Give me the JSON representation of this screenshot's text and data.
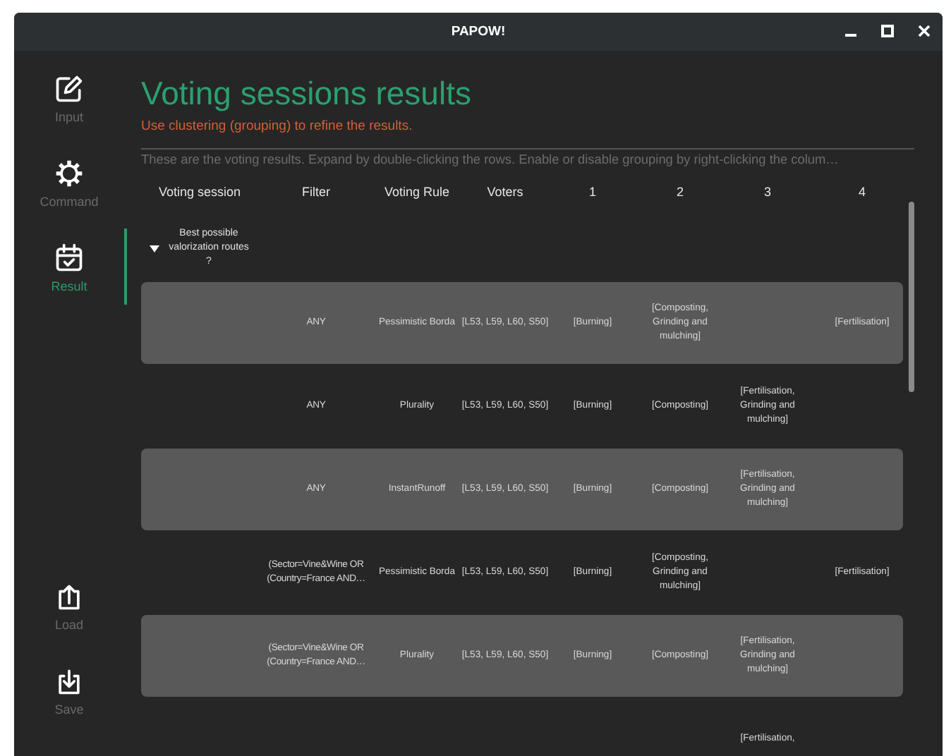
{
  "window": {
    "title": "PAPOW!"
  },
  "sidebar": {
    "top_items": [
      {
        "label": "Input",
        "selected": false
      },
      {
        "label": "Command",
        "selected": false
      },
      {
        "label": "Result",
        "selected": true
      }
    ],
    "bottom_items": [
      {
        "label": "Load",
        "selected": false
      },
      {
        "label": "Save",
        "selected": false
      }
    ]
  },
  "heading": "Voting sessions results",
  "hint": "Use clustering (grouping) to refine the results.",
  "description": "These are the voting results. Expand by double-clicking the rows. Enable or disable grouping by right-clicking the colum…",
  "table": {
    "columns": [
      "Voting session",
      "Filter",
      "Voting Rule",
      "Voters",
      "1",
      "2",
      "3",
      "4"
    ],
    "groups": [
      {
        "label": "Best possible valorization routes ?",
        "expanded": true,
        "rows": [
          {
            "shaded": true,
            "cells": [
              "",
              "ANY",
              "Pessimistic Borda",
              "[L53, L59, L60, S50]",
              "[Burning]",
              "[Composting, Grinding and mulching]",
              "",
              "[Fertilisation]"
            ]
          },
          {
            "shaded": false,
            "cells": [
              "",
              "ANY",
              "Plurality",
              "[L53, L59, L60, S50]",
              "[Burning]",
              "[Composting]",
              "[Fertilisation, Grinding and mulching]",
              ""
            ]
          },
          {
            "shaded": true,
            "cells": [
              "",
              "ANY",
              "InstantRunoff",
              "[L53, L59, L60, S50]",
              "[Burning]",
              "[Composting]",
              "[Fertilisation, Grinding and mulching]",
              ""
            ]
          },
          {
            "shaded": false,
            "cells": [
              "",
              "(Sector=Vine&Wine OR (Country=France AND…",
              "Pessimistic Borda",
              "[L53, L59, L60, S50]",
              "[Burning]",
              "[Composting, Grinding and mulching]",
              "",
              "[Fertilisation]"
            ]
          },
          {
            "shaded": true,
            "cells": [
              "",
              "(Sector=Vine&Wine OR (Country=France AND…",
              "Plurality",
              "[L53, L59, L60, S50]",
              "[Burning]",
              "[Composting]",
              "[Fertilisation, Grinding and mulching]",
              ""
            ]
          },
          {
            "shaded": false,
            "cells": [
              "",
              "",
              "",
              "",
              "",
              "",
              "[Fertilisation,",
              ""
            ]
          }
        ]
      }
    ]
  }
}
